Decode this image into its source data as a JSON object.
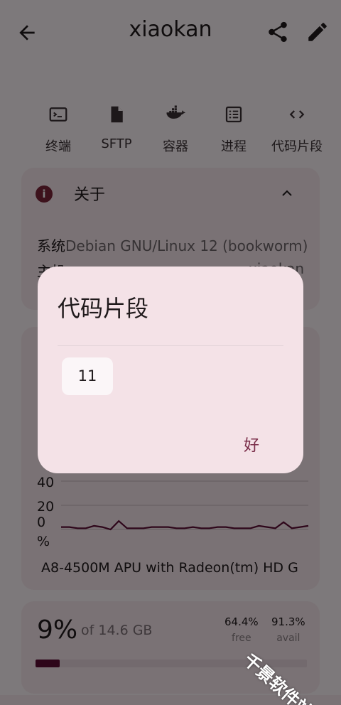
{
  "app_bar": {
    "title": "xiaokan"
  },
  "tools": [
    {
      "label": "终端",
      "icon": "terminal-icon"
    },
    {
      "label": "SFTP",
      "icon": "file-icon"
    },
    {
      "label": "容器",
      "icon": "docker-icon"
    },
    {
      "label": "进程",
      "icon": "list-icon"
    },
    {
      "label": "代码片段",
      "icon": "code-icon"
    }
  ],
  "about": {
    "title": "关于",
    "rows": [
      {
        "key": "系统",
        "value": "Debian GNU/Linux 12 (bookworm)"
      },
      {
        "key": "主机",
        "value": "xiaokan"
      }
    ]
  },
  "cpu": {
    "model": "A8-4500M APU with Radeon(tm) HD G",
    "unit": "%"
  },
  "chart_data": {
    "type": "line",
    "yticks": [
      "40",
      "20",
      "0"
    ],
    "ylabel": "%",
    "ylim": [
      0,
      50
    ],
    "values": [
      2,
      2,
      1,
      1,
      3,
      2,
      0,
      7,
      1,
      1,
      1,
      2,
      2,
      2,
      1,
      1,
      2,
      1,
      1,
      2,
      2,
      1,
      1,
      1,
      3,
      2,
      1,
      6,
      1,
      2,
      3
    ]
  },
  "memory": {
    "percent": "9%",
    "total": "of 14.6 GB",
    "free_value": "64.4%",
    "free_label": "free",
    "avail_value": "91.3%",
    "avail_label": "avail",
    "used_fraction": 0.09
  },
  "dialog": {
    "title": "代码片段",
    "snippet": "11",
    "ok_label": "好"
  },
  "watermark": "千景软件站",
  "colors": {
    "accent": "#5c0d35",
    "surface": "#f4e4ea",
    "background": "#fbf3f6",
    "line": "#5c0d35"
  }
}
